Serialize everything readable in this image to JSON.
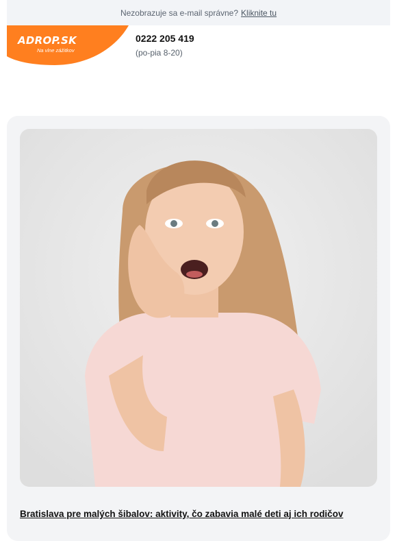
{
  "topbar": {
    "text": "Nezobrazuje sa e-mail správne?",
    "link": "Kliknite tu"
  },
  "logo": {
    "brand": "ADROP.SK",
    "tagline": "Na vlne zážitkov",
    "color": "#ff7f1f"
  },
  "contact": {
    "phone": "0222 205 419",
    "hours": "(po-pia 8-20)"
  },
  "article": {
    "image_alt": "surprised-girl-photo",
    "title": "Bratislava pre malých šibalov: aktivity, čo zabavia malé deti aj ich rodičov"
  }
}
